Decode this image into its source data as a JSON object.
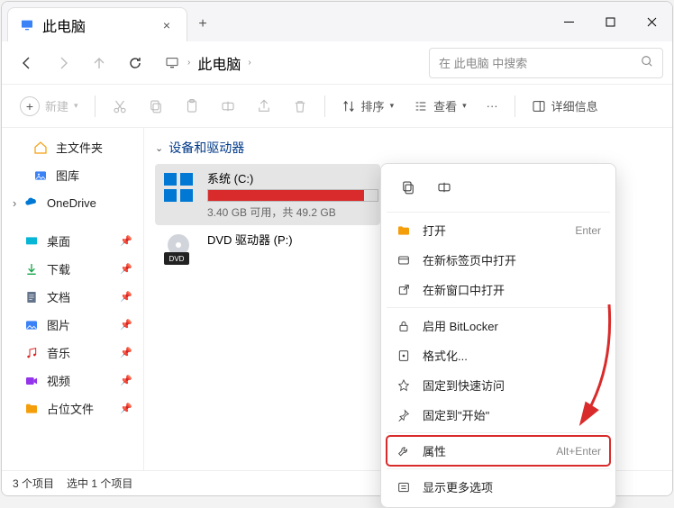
{
  "tab": {
    "title": "此电脑"
  },
  "breadcrumb": {
    "location": "此电脑"
  },
  "search": {
    "placeholder": "在 此电脑 中搜索"
  },
  "toolbar": {
    "new": "新建",
    "sort": "排序",
    "view": "查看",
    "details": "详细信息"
  },
  "sidebar": {
    "home": "主文件夹",
    "gallery": "图库",
    "onedrive": "OneDrive",
    "desktop": "桌面",
    "downloads": "下载",
    "documents": "文档",
    "pictures": "图片",
    "music": "音乐",
    "videos": "视频",
    "placeholder": "占位文件"
  },
  "content": {
    "group_header": "设备和驱动器",
    "drive_c": {
      "name": "系统 (C:)",
      "subtitle": "3.40 GB 可用，共 49.2 GB"
    },
    "dvd": {
      "name": "DVD 驱动器 (P:)",
      "badge": "DVD"
    }
  },
  "ctx": {
    "open": "打开",
    "open_shortcut": "Enter",
    "open_newtab": "在新标签页中打开",
    "open_newwin": "在新窗口中打开",
    "bitlocker": "启用 BitLocker",
    "format": "格式化...",
    "pin_quick": "固定到快速访问",
    "pin_start": "固定到\"开始\"",
    "properties": "属性",
    "properties_shortcut": "Alt+Enter",
    "more": "显示更多选项"
  },
  "status": {
    "items": "3 个项目",
    "selected": "选中 1 个项目"
  }
}
